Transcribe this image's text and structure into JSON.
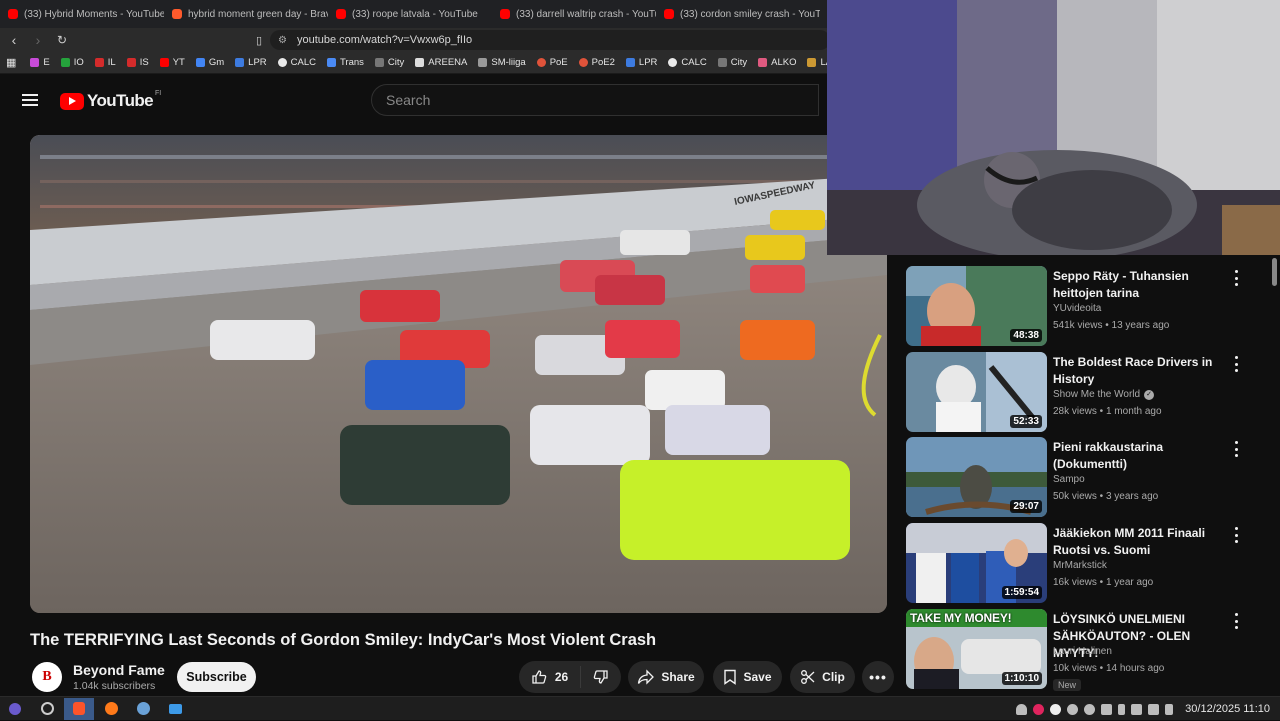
{
  "browser": {
    "tabs": [
      {
        "title": "(33) Hybrid Moments - YouTube",
        "color": "#ff0000"
      },
      {
        "title": "hybrid moment green day - Brav",
        "color": "#ff5a2c"
      },
      {
        "title": "(33) roope latvala - YouTube",
        "color": "#ff0000"
      },
      {
        "title": "(33) darrell waltrip crash - YouTu",
        "color": "#ff0000"
      },
      {
        "title": "(33) cordon smiley crash - YouTu",
        "color": "#ff0000"
      }
    ],
    "url": "youtube.com/watch?v=Vwxw6p_fIIo",
    "bookmarks": [
      "E",
      "IO",
      "IL",
      "IS",
      "YT",
      "Gm",
      "LPR",
      "CALC",
      "Trans",
      "City",
      "AREENA",
      "SM-liiga",
      "PoE",
      "PoE2",
      "LPR",
      "CALC",
      "City",
      "ALKO",
      "LA"
    ]
  },
  "youtube": {
    "logo_text": "YouTube",
    "country_code": "FI",
    "search_placeholder": "Search"
  },
  "video": {
    "title": "The TERRIFYING Last Seconds of Gordon Smiley: IndyCar's Most Violent Crash",
    "channel_name": "Beyond Fame",
    "channel_initial": "B",
    "subscribers": "1.04k subscribers",
    "subscribe_label": "Subscribe",
    "likes": "26",
    "share_label": "Share",
    "save_label": "Save",
    "clip_label": "Clip"
  },
  "sidebar": {
    "items": [
      {
        "title": "Seppo Räty - Tuhansien heittojen tarina",
        "channel": "YUvideoita",
        "verified": false,
        "meta": "541k views • 13 years ago",
        "duration": "48:38",
        "badge": ""
      },
      {
        "title": "The Boldest Race Drivers in History",
        "channel": "Show Me the World",
        "verified": true,
        "meta": "28k views • 1 month ago",
        "duration": "52:33",
        "badge": ""
      },
      {
        "title": "Pieni rakkaustarina (Dokumentti)",
        "channel": "Sampo",
        "verified": false,
        "meta": "50k views • 3 years ago",
        "duration": "29:07",
        "badge": ""
      },
      {
        "title": "Jääkiekon MM 2011 Finaali Ruotsi vs. Suomi",
        "channel": "MrMarkstick",
        "verified": false,
        "meta": "16k views • 1 year ago",
        "duration": "1:59:54",
        "badge": ""
      },
      {
        "title": "LÖYSINKÖ UNELMIENI SÄHKÖAUTON? - OLEN MYYTY!",
        "channel": "Lauri Halinen",
        "verified": false,
        "meta": "10k views • 14 hours ago",
        "duration": "1:10:10",
        "badge": "New",
        "thumb_text": "TAKE MY MONEY!"
      }
    ]
  },
  "taskbar": {
    "datetime": "30/12/2025 11:10"
  }
}
